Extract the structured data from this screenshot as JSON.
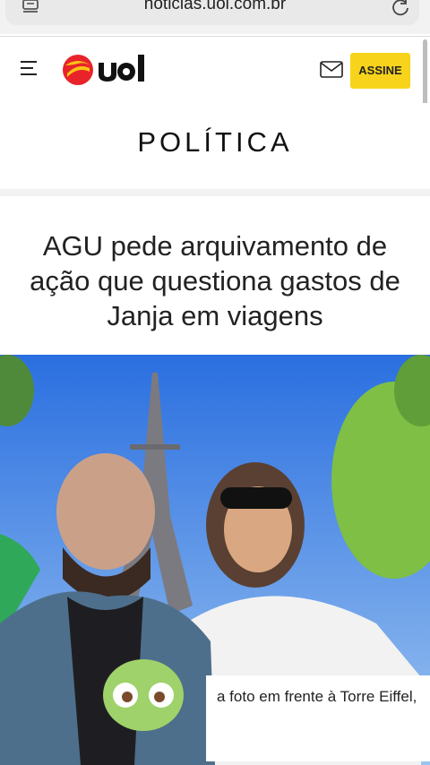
{
  "browser": {
    "url": "noticias.uol.com.br"
  },
  "header": {
    "logo_alt": "uol",
    "subscribe_label": "ASSINE"
  },
  "section": {
    "title": "POLÍTICA"
  },
  "article": {
    "headline": "AGU pede arquivamento de ação que questiona gastos de Janja em viagens",
    "caption_visible": "a foto em frente à Torre Eiffel,"
  },
  "colors": {
    "subscribe_bg": "#f7d31b",
    "logo_red": "#e8232a",
    "logo_yellow": "#f9c515"
  }
}
